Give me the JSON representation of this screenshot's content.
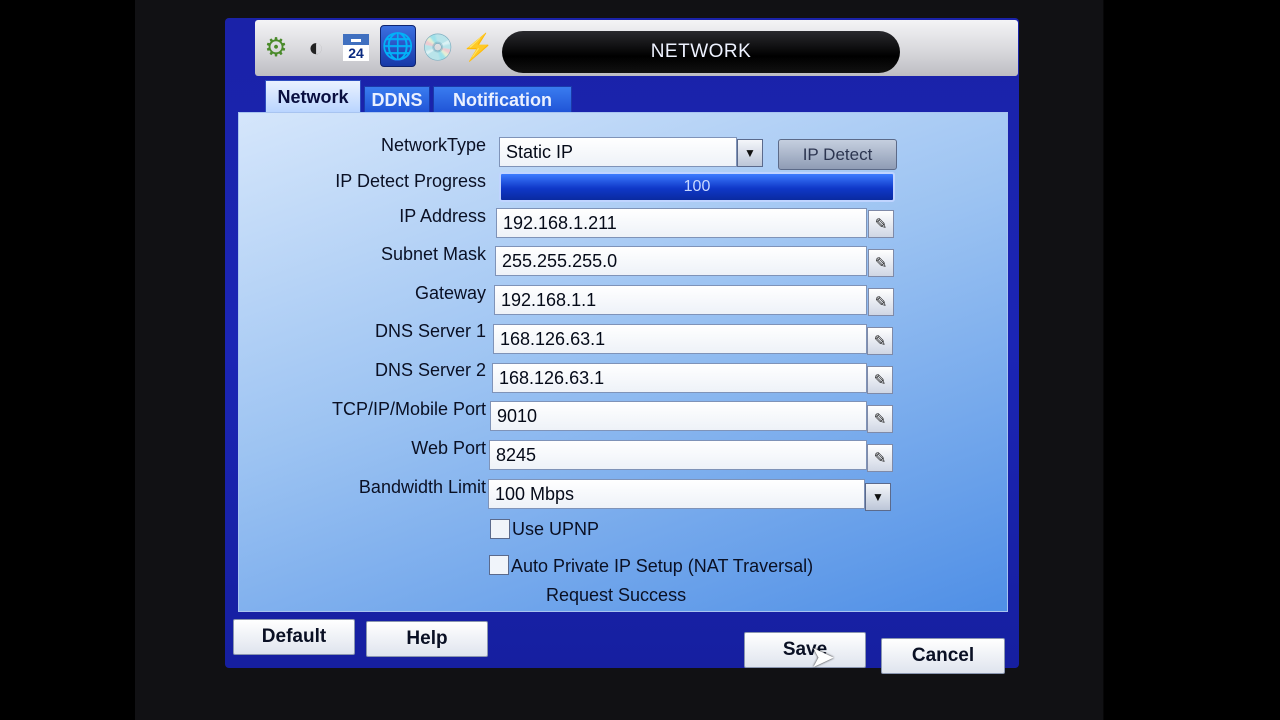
{
  "window": {
    "title": "NETWORK"
  },
  "toolbar": {
    "icons": [
      "gear-icon",
      "display-icon",
      "calendar-icon",
      "globe-icon",
      "disc-icon",
      "event-icon"
    ],
    "calendar_day": "24",
    "active_index": 3
  },
  "tabs": [
    {
      "label": "Network",
      "active": true
    },
    {
      "label": "DDNS",
      "active": false
    },
    {
      "label": "Notification",
      "active": false
    }
  ],
  "form": {
    "network_type": {
      "label": "NetworkType",
      "value": "Static IP"
    },
    "ip_detect_button": "IP Detect",
    "ip_detect_progress": {
      "label": "IP Detect Progress",
      "value": 100,
      "text": "100"
    },
    "ip_address": {
      "label": "IP Address",
      "value": "192.168.1.211"
    },
    "subnet_mask": {
      "label": "Subnet Mask",
      "value": "255.255.255.0"
    },
    "gateway": {
      "label": "Gateway",
      "value": "192.168.1.1"
    },
    "dns1": {
      "label": "DNS Server 1",
      "value": "168.126.63.1"
    },
    "dns2": {
      "label": "DNS Server 2",
      "value": "168.126.63.1"
    },
    "tcp_port": {
      "label": "TCP/IP/Mobile Port",
      "value": "9010"
    },
    "web_port": {
      "label": "Web Port",
      "value": "8245"
    },
    "bandwidth": {
      "label": "Bandwidth Limit",
      "value": "100 Mbps"
    },
    "use_upnp": {
      "label": "Use UPNP",
      "checked": false
    },
    "nat": {
      "label": "Auto Private IP Setup (NAT Traversal)",
      "checked": false
    },
    "status": "Request Success"
  },
  "buttons": {
    "default": "Default",
    "help": "Help",
    "save": "Save",
    "cancel": "Cancel"
  },
  "colors": {
    "frame": "#1b25b5",
    "panel_light": "#d5e6fb",
    "panel_dark": "#4f8fe6",
    "progress": "#0f38c8"
  }
}
